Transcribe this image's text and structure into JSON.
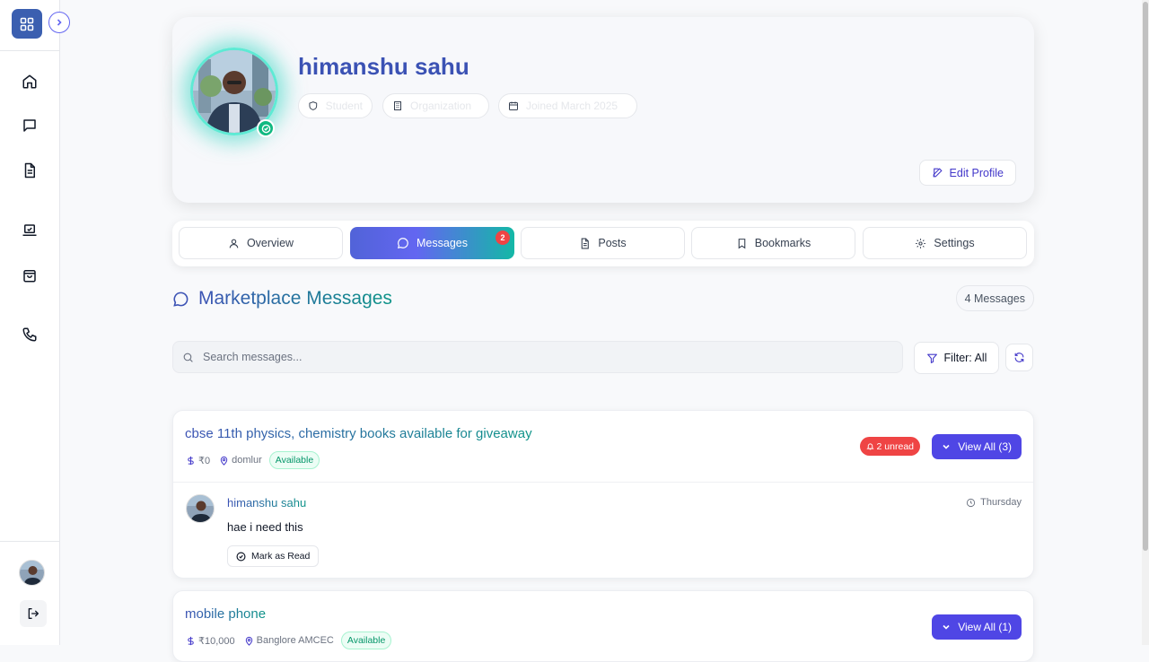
{
  "sidebar": {
    "items": [
      {
        "name": "home",
        "icon": "home-icon"
      },
      {
        "name": "chat",
        "icon": "chat-icon"
      },
      {
        "name": "documents",
        "icon": "document-icon"
      },
      {
        "name": "tasks",
        "icon": "check-laptop-icon"
      },
      {
        "name": "marketplace",
        "icon": "shopping-bag-icon"
      },
      {
        "name": "contact",
        "icon": "phone-icon"
      }
    ]
  },
  "profile": {
    "name": "himanshu sahu",
    "chips": [
      {
        "icon": "shield-icon",
        "label": "Student"
      },
      {
        "icon": "building-icon",
        "label": "Organization"
      },
      {
        "icon": "calendar-icon",
        "label": "Joined March 2025"
      }
    ],
    "edit_label": "Edit Profile"
  },
  "tabs": [
    {
      "label": "Overview",
      "icon": "user-icon",
      "active": false
    },
    {
      "label": "Messages",
      "icon": "message-icon",
      "active": true,
      "badge": "2"
    },
    {
      "label": "Posts",
      "icon": "document-icon",
      "active": false
    },
    {
      "label": "Bookmarks",
      "icon": "bookmark-icon",
      "active": false
    },
    {
      "label": "Settings",
      "icon": "gear-icon",
      "active": false
    }
  ],
  "messages_section": {
    "title": "Marketplace Messages",
    "count_label": "4 Messages",
    "search_placeholder": "Search messages...",
    "filter_label": "Filter: All"
  },
  "listings": [
    {
      "title": "cbse 11th physics, chemistry books available for giveaway",
      "price": "₹0",
      "location": "domlur",
      "status": "Available",
      "unread": "2 unread",
      "view_all": "View All (3)",
      "message": {
        "sender": "himanshu sahu",
        "time": "Thursday",
        "text": "hae i need this",
        "mark_read": "Mark as Read"
      }
    },
    {
      "title": "mobile phone",
      "price": "₹10,000",
      "location": "Banglore AMCEC",
      "status": "Available",
      "view_all": "View All (1)"
    }
  ],
  "colors": {
    "accent": "#4f46e5",
    "brand_blue": "#3b52b4",
    "teal": "#0d9488",
    "danger": "#ef4444",
    "success": "#10b981"
  }
}
